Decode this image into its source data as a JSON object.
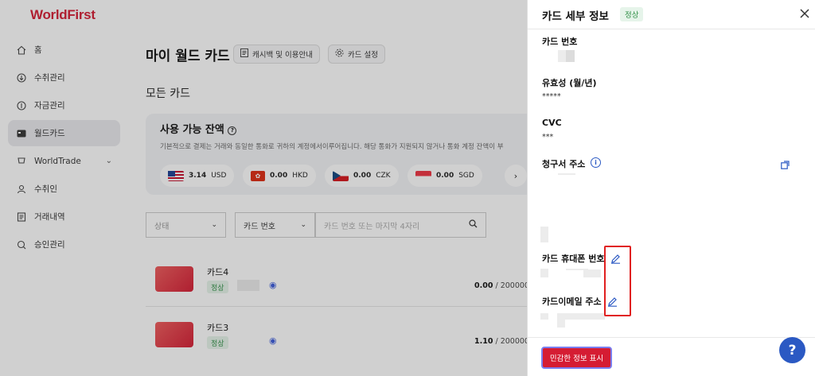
{
  "brand": {
    "logo": "WorldFirst"
  },
  "sidebar": {
    "items": [
      {
        "label": "홈",
        "icon": "home-icon"
      },
      {
        "label": "수취관리",
        "icon": "receive-icon"
      },
      {
        "label": "자금관리",
        "icon": "funds-icon"
      },
      {
        "label": "월드카드",
        "icon": "card-icon",
        "active": true
      },
      {
        "label": "WorldTrade",
        "icon": "trade-icon",
        "chevron": "⌄"
      },
      {
        "label": "수취인",
        "icon": "recipient-icon"
      },
      {
        "label": "거래내역",
        "icon": "history-icon"
      },
      {
        "label": "승인관리",
        "icon": "approval-icon"
      }
    ]
  },
  "main": {
    "title": "마이 월드 카드",
    "btn_cashback": "캐시백 및 이용안내",
    "btn_settings": "카드 설정",
    "section_all_cards": "모든 카드",
    "balance": {
      "title": "사용 가능 잔액",
      "desc": "기본적으로 결제는 거래와 동일한 통화로 귀하의 계정에서이루어집니다. 해당 통화가 지원되지 않거나 통화 계정 잔액이 부",
      "currencies": [
        {
          "amount": "3.14",
          "code": "USD"
        },
        {
          "amount": "0.00",
          "code": "HKD"
        },
        {
          "amount": "0.00",
          "code": "CZK"
        },
        {
          "amount": "0.00",
          "code": "SGD"
        }
      ],
      "more": "›"
    },
    "filters": {
      "status_placeholder": "상태",
      "type_value": "카드 번호",
      "search_placeholder": "카드 번호 또는 마지막 4자리"
    },
    "cards": [
      {
        "name": "카드4",
        "status": "정상",
        "amount": "0.00",
        "limit": "/ 200000.0"
      },
      {
        "name": "카드3",
        "status": "정상",
        "amount": "1.10",
        "limit": "/ 200000.0"
      }
    ]
  },
  "drawer": {
    "title": "카드 세부 정보",
    "status": "정상",
    "card_number_label": "카드 번호",
    "expiry_label": "유효성 (월/년)",
    "expiry_value": "*****",
    "cvc_label": "CVC",
    "cvc_value": "***",
    "billing_label": "청구서 주소",
    "phone_label": "카드 휴대폰 번호",
    "email_label": "카드이메일 주소",
    "show_button": "민감한 정보 표시"
  },
  "help": "?",
  "colors": {
    "brand": "#d51c33",
    "accent": "#2b59c3",
    "ok": "#2f8f46"
  }
}
